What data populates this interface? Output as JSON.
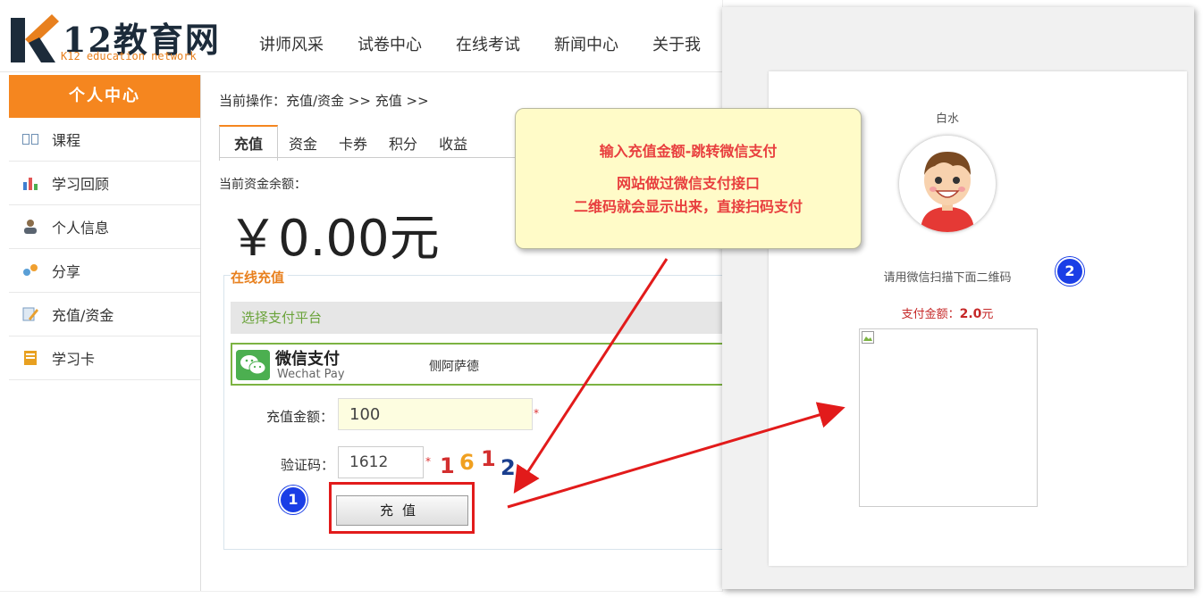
{
  "header": {
    "logo_title": "12教育网",
    "logo_subtitle": "K12 education network",
    "nav": [
      "讲师风采",
      "试卷中心",
      "在线考试",
      "新闻中心",
      "关于我"
    ]
  },
  "sidebar": {
    "title": "个人中心",
    "items": [
      {
        "label": "课程",
        "icon": "book-icon"
      },
      {
        "label": "学习回顾",
        "icon": "bar-chart-icon"
      },
      {
        "label": "个人信息",
        "icon": "user-icon"
      },
      {
        "label": "分享",
        "icon": "share-icon"
      },
      {
        "label": "充值/资金",
        "icon": "edit-icon"
      },
      {
        "label": "学习卡",
        "icon": "card-icon"
      }
    ]
  },
  "main": {
    "breadcrumb": "当前操作：充值/资金 >> 充值 >>",
    "tabs": [
      "充值",
      "资金",
      "卡券",
      "积分",
      "收益"
    ],
    "balance_label": "当前资金余额：",
    "balance_value": "￥0.00元",
    "recharge_title": "在线充值",
    "platform_label": "选择支付平台",
    "wechat": {
      "name": "微信支付",
      "name_en": "Wechat Pay",
      "desc": "侧阿萨德"
    },
    "amount_label": "充值金额：",
    "amount_value": "100",
    "captcha_label": "验证码：",
    "captcha_value": "1612",
    "captcha_digits": [
      "1",
      "6",
      "1",
      "2"
    ],
    "required_mark": "*",
    "submit_label": "充值"
  },
  "annotations": {
    "badge1": "1",
    "badge2": "2",
    "tooltip_line1": "输入充值金额-跳转微信支付",
    "tooltip_line2": "网站做过微信支付接口",
    "tooltip_line3": "二维码就会显示出来，直接扫码支付"
  },
  "payment_panel": {
    "user_name": "白水",
    "scan_tip": "请用微信扫描下面二维码",
    "amount_label": "支付金额：",
    "amount_value": "2.0",
    "amount_unit": "元"
  },
  "colors": {
    "accent_orange": "#f5861f",
    "highlight_red": "#e21b1b",
    "badge_blue": "#1a3ee6",
    "wechat_green": "#7cb342",
    "tooltip_bg": "#fffbc8"
  }
}
